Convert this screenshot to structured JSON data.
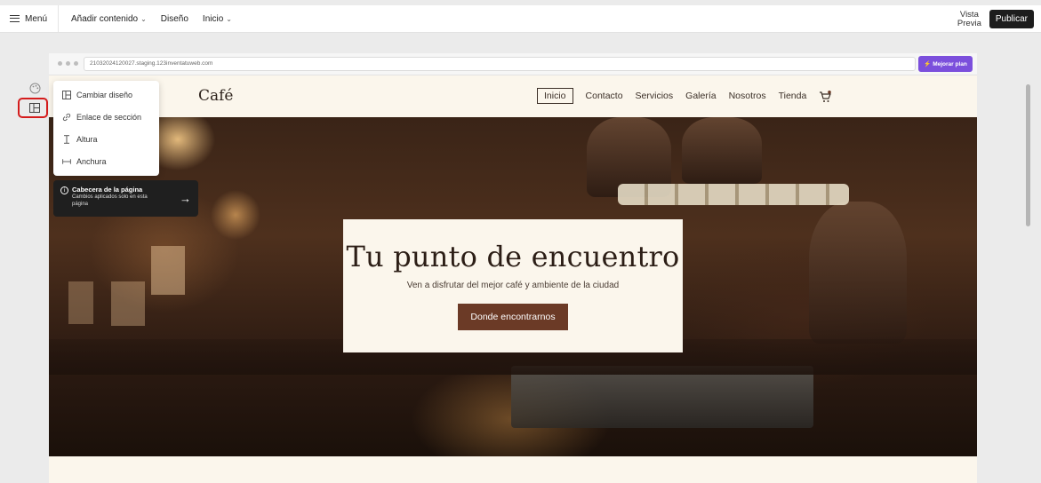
{
  "topbar": {
    "menu_label": "Menú",
    "nav": [
      {
        "label": "Añadir contenido",
        "caret": true
      },
      {
        "label": "Diseño",
        "caret": false
      },
      {
        "label": "Inicio",
        "caret": true
      }
    ],
    "preview_label_1": "Vista",
    "preview_label_2": "Previa",
    "publish_label": "Publicar"
  },
  "side_tools": [
    {
      "icon": "palette-icon"
    },
    {
      "icon": "layout-icon",
      "highlighted": true
    }
  ],
  "browser": {
    "url": "21032024120027.staging.123inventatuweb.com",
    "upgrade_label": "Mejorar plan",
    "accent": "#7b4fdc"
  },
  "site": {
    "logo": "Café",
    "nav": [
      "Inicio",
      "Contacto",
      "Servicios",
      "Galería",
      "Nosotros",
      "Tienda"
    ],
    "active_nav": "Inicio",
    "cart_icon": "cart-icon"
  },
  "hero": {
    "title": "Tu punto de encuentro",
    "subtitle": "Ven a disfrutar del mejor café y ambiente de la ciudad",
    "cta": "Donde encontrarnos",
    "cta_color": "#6b3a26"
  },
  "popover": {
    "items": [
      {
        "label": "Cambiar diseño",
        "icon": "layout-icon"
      },
      {
        "label": "Enlace de sección",
        "icon": "link-icon"
      },
      {
        "label": "Altura",
        "icon": "height-icon"
      },
      {
        "label": "Anchura",
        "icon": "width-icon"
      }
    ]
  },
  "tooltip": {
    "title": "Cabecera de la página",
    "description": "Cambios aplicados solo en esta página",
    "icon": "info-icon"
  }
}
